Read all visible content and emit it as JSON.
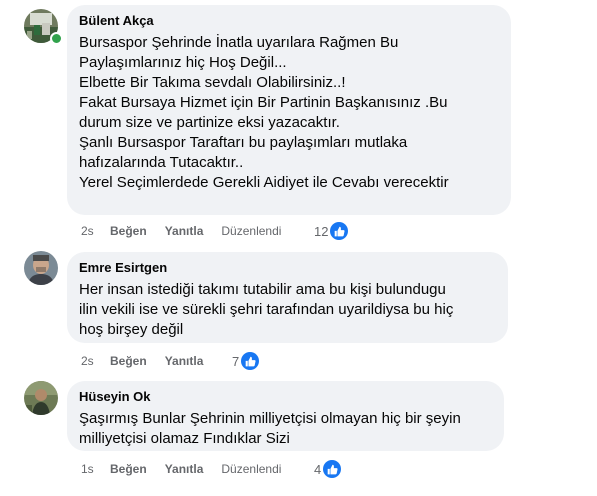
{
  "comments": [
    {
      "author": "Bülent Akça",
      "avatar": "bulent-avatar-photo",
      "online": true,
      "lines": [
        "Bursaspor Şehrinde İnatla uyarılara Rağmen Bu",
        "Paylaşımlarınız hiç Hoş Değil...",
        "Elbette Bir Takıma sevdalı Olabilirsiniz..!",
        "Fakat Bursaya Hizmet için Bir Partinin Başkanısınız .Bu",
        "durum size ve partinize eksi yazacaktır.",
        "Şanlı Bursaspor Taraftarı bu paylaşımları mutlaka",
        "hafızalarında Tutacaktır..",
        "Yerel Seçimlerdede Gerekli Aidiyet ile Cevabı verecektir"
      ],
      "time": "2s",
      "like_label": "Beğen",
      "reply_label": "Yanıtla",
      "edited_label": "Düzenlendi",
      "reaction_count": "12",
      "reaction_icon": "like-thumb-icon"
    },
    {
      "author": "Emre Esirtgen",
      "avatar": "emre-avatar-photo",
      "online": false,
      "lines": [
        "Her insan istediği takımı tutabilir ama bu kişi bulundugu",
        "ilin vekili ise ve sürekli şehri tarafından uyarildiysa bu hiç",
        "hoş birşey değil"
      ],
      "time": "2s",
      "like_label": "Beğen",
      "reply_label": "Yanıtla",
      "edited_label": "",
      "reaction_count": "7",
      "reaction_icon": "like-thumb-icon"
    },
    {
      "author": "Hüseyin Ok",
      "avatar": "huseyin-avatar-photo",
      "online": false,
      "lines": [
        "Şaşırmış Bunlar Şehrinin milliyetçisi olmayan hiç bir şeyin",
        "milliyetçisi olamaz Fındıklar Sizi"
      ],
      "time": "1s",
      "like_label": "Beğen",
      "reply_label": "Yanıtla",
      "edited_label": "Düzenlendi",
      "reaction_count": "4",
      "reaction_icon": "like-thumb-icon"
    }
  ],
  "colors": {
    "bubble": "#f0f2f5",
    "text": "#050505",
    "secondary": "#65676b",
    "like_blue": "#1877f2",
    "online_green": "#31a24c"
  }
}
